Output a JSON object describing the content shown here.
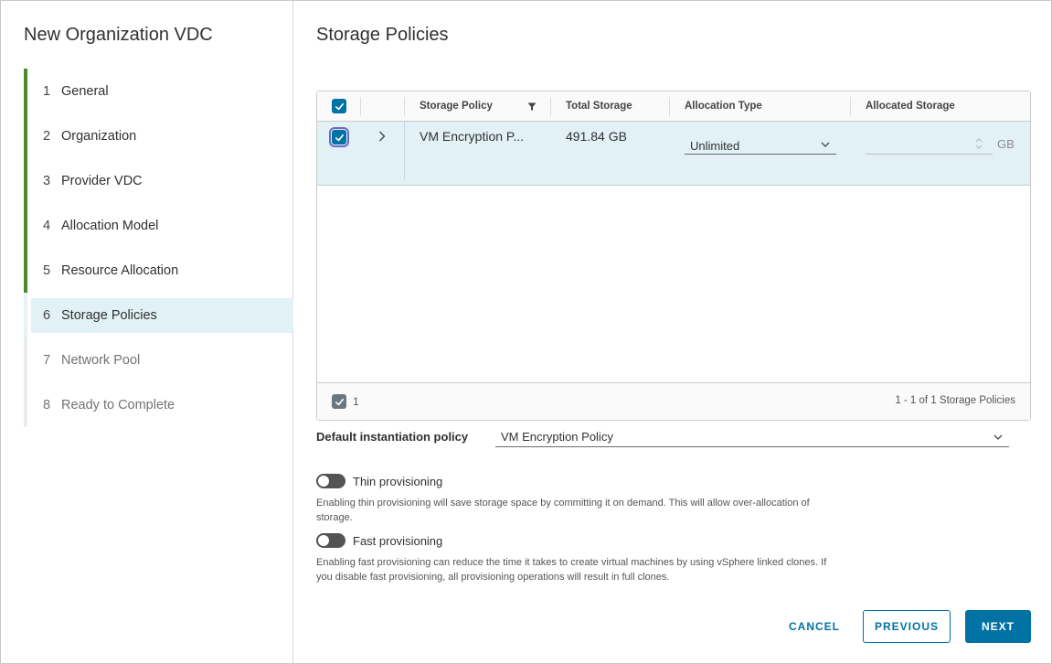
{
  "wizard": {
    "title": "New Organization VDC",
    "steps": [
      {
        "num": "1",
        "label": "General",
        "state": "done"
      },
      {
        "num": "2",
        "label": "Organization",
        "state": "done"
      },
      {
        "num": "3",
        "label": "Provider VDC",
        "state": "done"
      },
      {
        "num": "4",
        "label": "Allocation Model",
        "state": "done"
      },
      {
        "num": "5",
        "label": "Resource Allocation",
        "state": "done"
      },
      {
        "num": "6",
        "label": "Storage Policies",
        "state": "current"
      },
      {
        "num": "7",
        "label": "Network Pool",
        "state": "future"
      },
      {
        "num": "8",
        "label": "Ready to Complete",
        "state": "future"
      }
    ]
  },
  "page": {
    "title": "Storage Policies"
  },
  "grid": {
    "headers": {
      "storage_policy": "Storage Policy",
      "total_storage": "Total Storage",
      "allocation_type": "Allocation Type",
      "allocated_storage": "Allocated Storage"
    },
    "rows": [
      {
        "selected": true,
        "storage_policy": "VM Encryption P...",
        "total_storage": "491.84 GB",
        "allocation_type": "Unlimited",
        "allocated_storage": "",
        "unit": "GB"
      }
    ],
    "footer": {
      "selected_count": "1",
      "pagination": "1 - 1 of 1 Storage Policies"
    }
  },
  "default_policy": {
    "label": "Default instantiation policy",
    "value": "VM Encryption Policy"
  },
  "thin_provisioning": {
    "label": "Thin provisioning",
    "enabled": false,
    "help": "Enabling thin provisioning will save storage space by committing it on demand. This will allow over-allocation of storage."
  },
  "fast_provisioning": {
    "label": "Fast provisioning",
    "enabled": false,
    "help": "Enabling fast provisioning can reduce the time it takes to create virtual machines by using vSphere linked clones. If you disable fast provisioning, all provisioning operations will result in full clones."
  },
  "buttons": {
    "cancel": "CANCEL",
    "previous": "PREVIOUS",
    "next": "NEXT"
  },
  "colors": {
    "accent": "#0072a3",
    "step_done": "#4a8a2c",
    "row_selected": "#e1f1f6"
  },
  "icons": {
    "filter": "filter-icon",
    "expand": "chevron-right-icon",
    "dropdown": "chevron-down-icon",
    "checkbox": "checkmark-icon",
    "spinner": "spinner-arrows-icon"
  }
}
